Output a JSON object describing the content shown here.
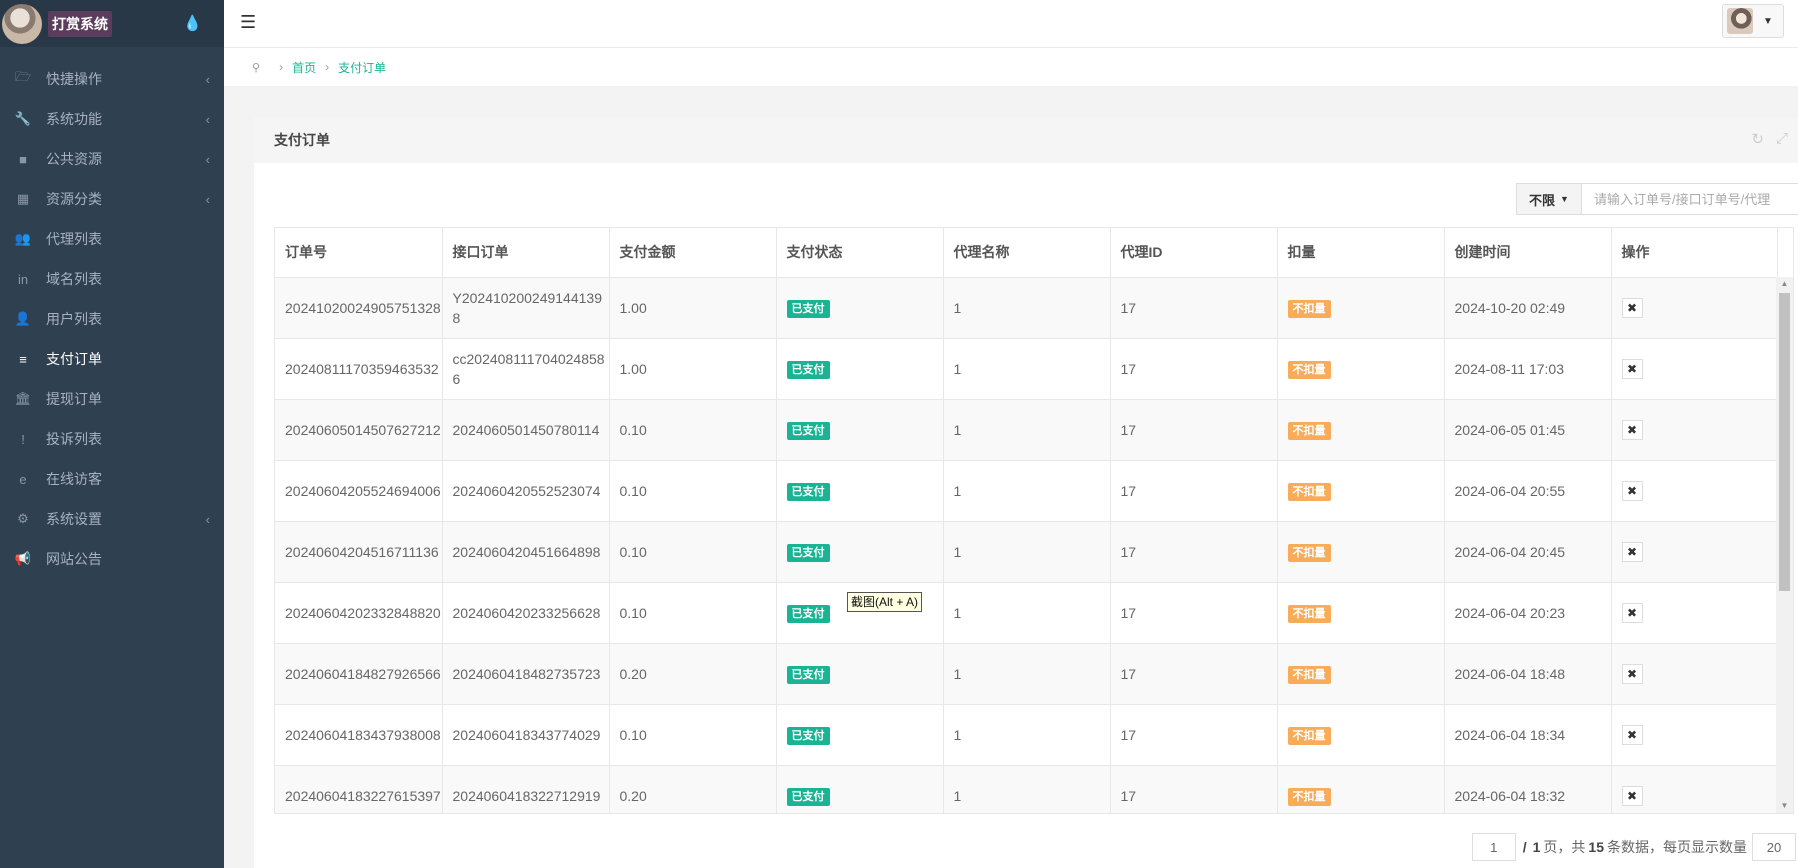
{
  "brand": {
    "name": "打赏系统"
  },
  "sidebar": {
    "items": [
      {
        "label": "快捷操作",
        "icon": "folder-open-icon",
        "glyph": "🗁",
        "arrow": true,
        "active": false
      },
      {
        "label": "系统功能",
        "icon": "wrench-icon",
        "glyph": "🔧",
        "arrow": true,
        "active": false
      },
      {
        "label": "公共资源",
        "icon": "video-camera-icon",
        "glyph": "■",
        "arrow": true,
        "active": false
      },
      {
        "label": "资源分类",
        "icon": "grid-icon",
        "glyph": "▦",
        "arrow": true,
        "active": false
      },
      {
        "label": "代理列表",
        "icon": "users-icon",
        "glyph": "👥",
        "arrow": false,
        "active": false
      },
      {
        "label": "域名列表",
        "icon": "linkedin-icon",
        "glyph": "in",
        "arrow": false,
        "active": false
      },
      {
        "label": "用户列表",
        "icon": "user-icon",
        "glyph": "👤",
        "arrow": false,
        "active": false
      },
      {
        "label": "支付订单",
        "icon": "database-icon",
        "glyph": "≡",
        "arrow": false,
        "active": true
      },
      {
        "label": "提现订单",
        "icon": "bank-icon",
        "glyph": "🏛",
        "arrow": false,
        "active": false
      },
      {
        "label": "投诉列表",
        "icon": "exclamation-circle-icon",
        "glyph": "!",
        "arrow": false,
        "active": false
      },
      {
        "label": "在线访客",
        "icon": "internet-explorer-icon",
        "glyph": "e",
        "arrow": false,
        "active": false
      },
      {
        "label": "系统设置",
        "icon": "gear-icon",
        "glyph": "⚙",
        "arrow": true,
        "active": false
      },
      {
        "label": "网站公告",
        "icon": "bullhorn-icon",
        "glyph": "📢",
        "arrow": false,
        "active": false
      }
    ]
  },
  "breadcrumb": {
    "home": "首页",
    "current": "支付订单"
  },
  "panel": {
    "title": "支付订单"
  },
  "filter": {
    "select": "不限",
    "placeholder": "请输入订单号/接口订单号/代理"
  },
  "table": {
    "columns": [
      "订单号",
      "接口订单",
      "支付金额",
      "支付状态",
      "代理名称",
      "代理ID",
      "扣量",
      "创建时间",
      "操作"
    ],
    "rows": [
      {
        "order": "20241020024905751328",
        "iface": "Y2024102002491441398",
        "amount": "1.00",
        "status": "已支付",
        "agent": "1",
        "agent_id": "17",
        "deduct": "不扣量",
        "time": "2024-10-20 02:49"
      },
      {
        "order": "20240811170359463532",
        "iface": "cc2024081117040248586",
        "amount": "1.00",
        "status": "已支付",
        "agent": "1",
        "agent_id": "17",
        "deduct": "不扣量",
        "time": "2024-08-11 17:03"
      },
      {
        "order": "20240605014507627212",
        "iface": "2024060501450780114",
        "amount": "0.10",
        "status": "已支付",
        "agent": "1",
        "agent_id": "17",
        "deduct": "不扣量",
        "time": "2024-06-05 01:45"
      },
      {
        "order": "20240604205524694006",
        "iface": "2024060420552523074",
        "amount": "0.10",
        "status": "已支付",
        "agent": "1",
        "agent_id": "17",
        "deduct": "不扣量",
        "time": "2024-06-04 20:55"
      },
      {
        "order": "20240604204516711136",
        "iface": "2024060420451664898",
        "amount": "0.10",
        "status": "已支付",
        "agent": "1",
        "agent_id": "17",
        "deduct": "不扣量",
        "time": "2024-06-04 20:45"
      },
      {
        "order": "20240604202332848820",
        "iface": "2024060420233256628",
        "amount": "0.10",
        "status": "已支付",
        "agent": "1",
        "agent_id": "17",
        "deduct": "不扣量",
        "time": "2024-06-04 20:23"
      },
      {
        "order": "20240604184827926566",
        "iface": "2024060418482735723",
        "amount": "0.20",
        "status": "已支付",
        "agent": "1",
        "agent_id": "17",
        "deduct": "不扣量",
        "time": "2024-06-04 18:48"
      },
      {
        "order": "20240604183437938008",
        "iface": "2024060418343774029",
        "amount": "0.10",
        "status": "已支付",
        "agent": "1",
        "agent_id": "17",
        "deduct": "不扣量",
        "time": "2024-06-04 18:34"
      },
      {
        "order": "20240604183227615397",
        "iface": "2024060418322712919",
        "amount": "0.20",
        "status": "已支付",
        "agent": "1",
        "agent_id": "17",
        "deduct": "不扣量",
        "time": "2024-06-04 18:32"
      }
    ]
  },
  "tooltip": "截图(Alt + A)",
  "pagination": {
    "current_page": "1",
    "sep": "/",
    "total_pages": "1",
    "page_label": "页，共",
    "total_count": "15",
    "count_label": "条数据，每页显示数量",
    "page_size": "20"
  }
}
